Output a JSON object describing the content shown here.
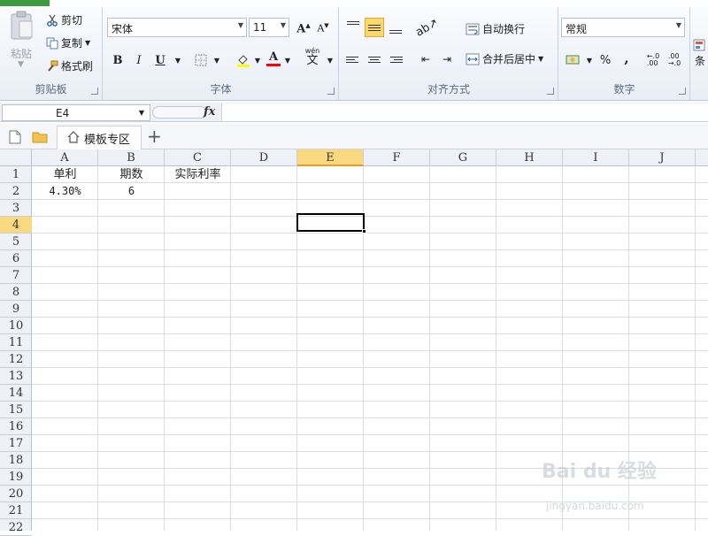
{
  "ribbon": {
    "clipboard": {
      "paste_label": "粘贴",
      "cut_label": "剪切",
      "copy_label": "复制",
      "format_painter_label": "格式刷",
      "group_label": "剪贴板"
    },
    "font": {
      "font_name": "宋体",
      "font_size": "11",
      "bold_label": "B",
      "italic_label": "I",
      "underline_label": "U",
      "wen_label": "wén",
      "group_label": "字体",
      "fill_color": "#ffff00",
      "font_color": "#ff0000"
    },
    "alignment": {
      "wrap_text_label": "自动换行",
      "merge_center_label": "合并后居中",
      "group_label": "对齐方式"
    },
    "number": {
      "format_value": "常规",
      "percent_label": "%",
      "comma_label": ",",
      "group_label": "数字"
    },
    "styles": {
      "cut_label": "条"
    }
  },
  "formula_bar": {
    "name_box": "E4",
    "fx_label": "fx",
    "formula": ""
  },
  "doc_tabs": {
    "tab_label": "模板专区",
    "add_label": "+"
  },
  "grid": {
    "columns": [
      "A",
      "B",
      "C",
      "D",
      "E",
      "F",
      "G",
      "H",
      "I",
      "J"
    ],
    "rows": [
      "1",
      "2",
      "3",
      "4",
      "5",
      "6",
      "7",
      "8",
      "9",
      "10",
      "11",
      "12",
      "13",
      "14",
      "15",
      "16",
      "17",
      "18",
      "19",
      "20",
      "21",
      "22"
    ],
    "selected_cell": "E4",
    "cells": {
      "A1": "单利",
      "B1": "期数",
      "C1": "实际利率",
      "A2": "4.30%",
      "B2": "6"
    }
  },
  "watermark": {
    "main": "Bai du 经验",
    "sub": "jingyan.baidu.com"
  }
}
